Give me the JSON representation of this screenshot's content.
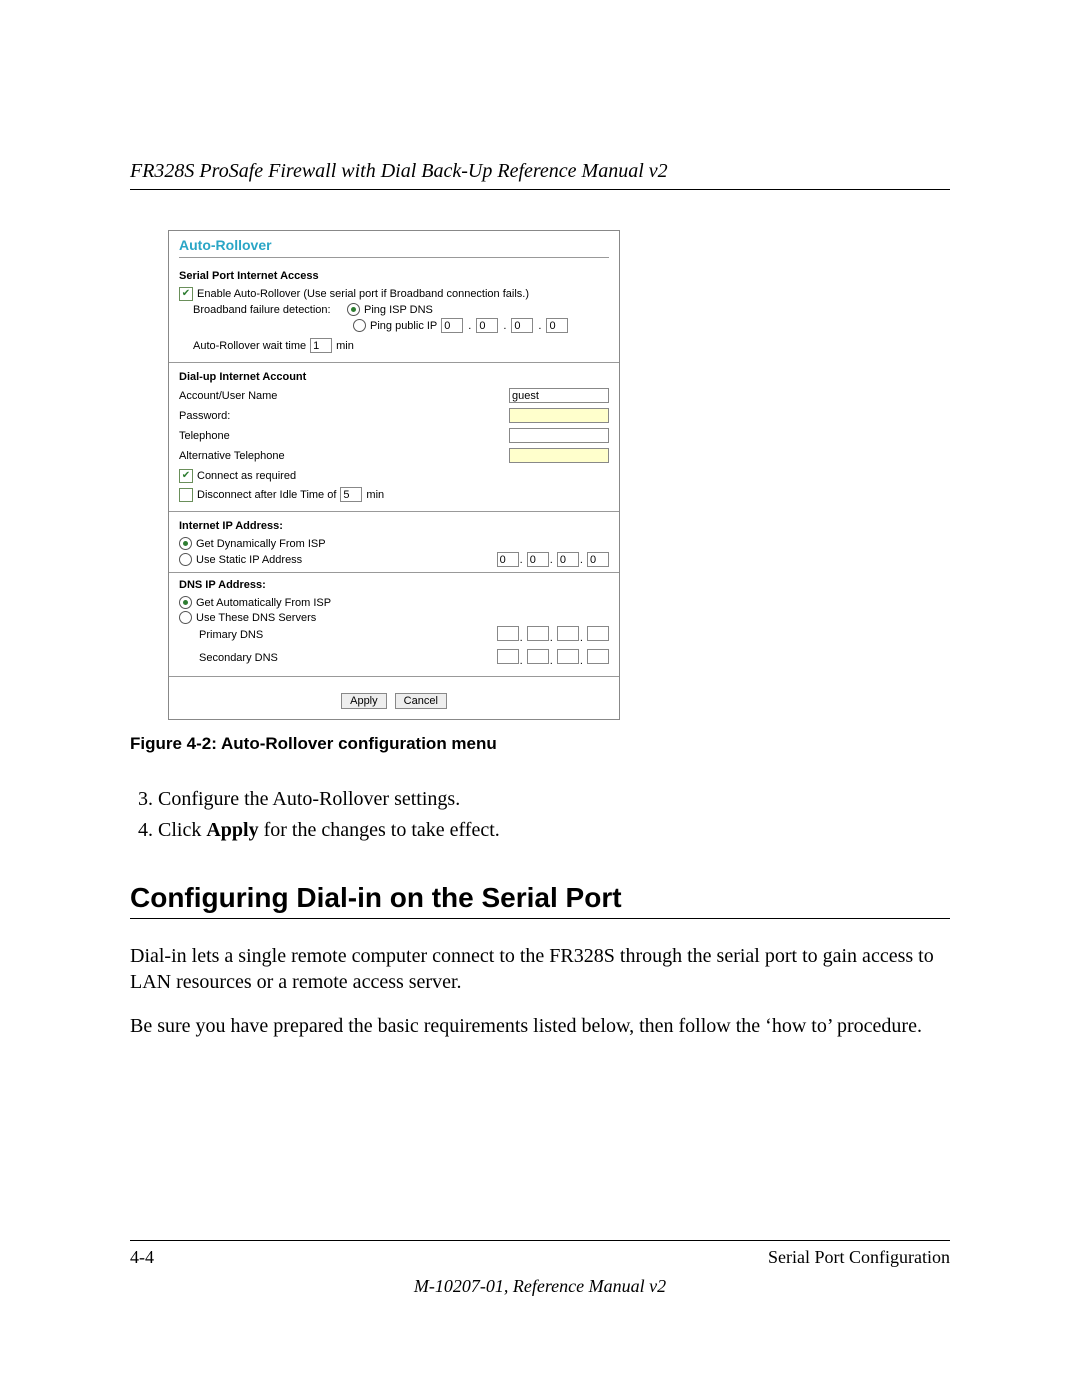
{
  "running_head": "FR328S ProSafe Firewall with Dial Back-Up Reference Manual v2",
  "screenshot": {
    "title": "Auto-Rollover",
    "serial_access_label": "Serial Port Internet Access",
    "enable_label": "Enable Auto-Rollover (Use serial port if Broadband connection fails.)",
    "enable_checked": "✔",
    "detection_label": "Broadband failure detection:",
    "ping_isp_label": "Ping ISP DNS",
    "ping_public_label": "Ping public IP",
    "public_ip": [
      "0",
      "0",
      "0",
      "0"
    ],
    "wait_label": "Auto-Rollover wait time",
    "wait_value": "1",
    "wait_unit": "min",
    "dialup_label": "Dial-up Internet Account",
    "account_label": "Account/User Name",
    "account_value": "guest",
    "password_label": "Password:",
    "telephone_label": "Telephone",
    "alt_telephone_label": "Alternative Telephone",
    "connect_required_label": "Connect as required",
    "connect_required_checked": "✔",
    "disconnect_label_pre": "Disconnect after Idle Time of",
    "disconnect_value": "5",
    "disconnect_unit": "min",
    "internet_ip_label": "Internet IP Address:",
    "get_dynamic_label": "Get Dynamically From ISP",
    "use_static_label": "Use Static IP Address",
    "static_ip": [
      "0",
      "0",
      "0",
      "0"
    ],
    "dns_ip_label": "DNS IP Address:",
    "get_auto_dns_label": "Get Automatically From ISP",
    "use_dns_servers_label": "Use These DNS Servers",
    "primary_dns_label": "Primary DNS",
    "secondary_dns_label": "Secondary DNS",
    "apply_btn": "Apply",
    "cancel_btn": "Cancel"
  },
  "figure_caption": "Figure 4-2:  Auto-Rollover configuration menu",
  "list": {
    "item3_num": "3.",
    "item3": "Configure the Auto-Rollover settings.",
    "item4_pre": "Click ",
    "item4_bold": "Apply",
    "item4_post": " for the changes to take effect."
  },
  "section_heading": "Configuring Dial-in on the Serial Port",
  "para1": "Dial-in lets a single remote computer connect to the FR328S through the serial port to gain access to LAN resources or a remote access server.",
  "para2": "Be sure you have prepared the basic requirements listed below, then follow the ‘how to’ procedure.",
  "footer": {
    "page": "4-4",
    "right": "Serial Port Configuration",
    "doc": "M-10207-01, Reference Manual v2"
  }
}
